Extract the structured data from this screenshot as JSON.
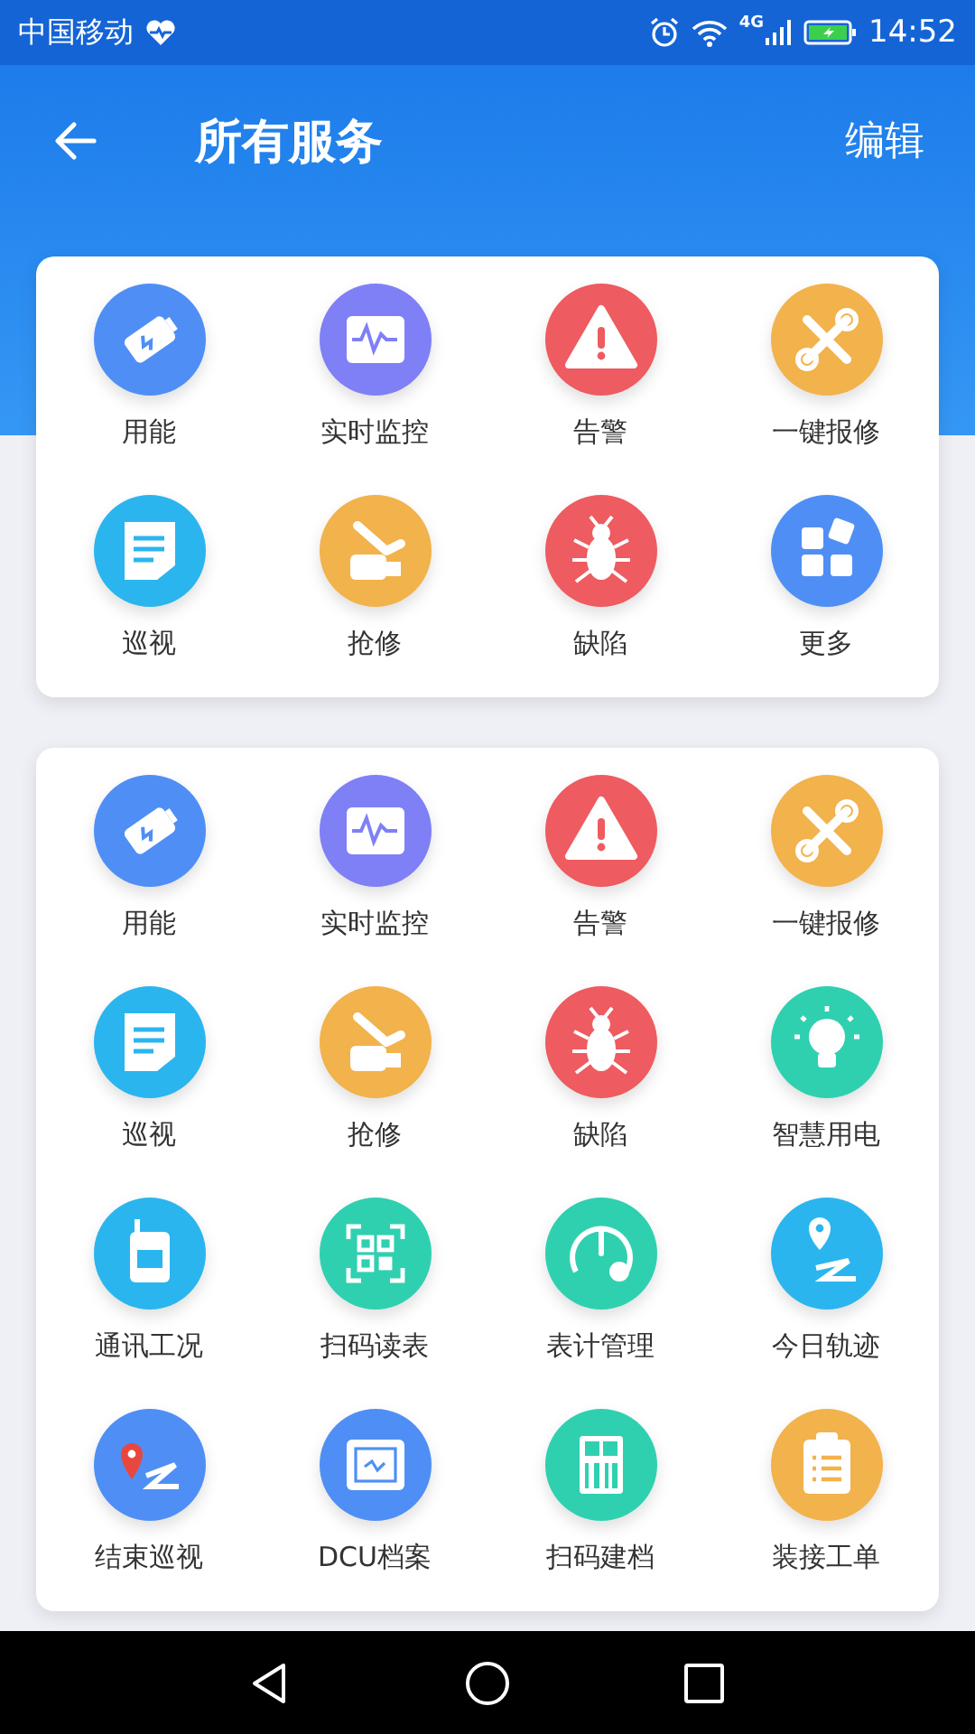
{
  "status_bar": {
    "carrier": "中国移动",
    "network": "4G",
    "time": "14:52"
  },
  "header": {
    "title": "所有服务",
    "action": "编辑"
  },
  "sections": [
    {
      "items": [
        {
          "label": "用能",
          "kind": "battery",
          "color": "#4f8ff5"
        },
        {
          "label": "实时监控",
          "kind": "monitor",
          "color": "#7f80f6"
        },
        {
          "label": "告警",
          "kind": "warning",
          "color": "#ee5b60"
        },
        {
          "label": "一键报修",
          "kind": "tools",
          "color": "#f2b24c"
        },
        {
          "label": "巡视",
          "kind": "document",
          "color": "#2bb5ee"
        },
        {
          "label": "抢修",
          "kind": "repair",
          "color": "#f2b24c"
        },
        {
          "label": "缺陷",
          "kind": "bug",
          "color": "#ee5b60"
        },
        {
          "label": "更多",
          "kind": "grid",
          "color": "#4f8ff5"
        }
      ]
    },
    {
      "items": [
        {
          "label": "用能",
          "kind": "battery",
          "color": "#4f8ff5"
        },
        {
          "label": "实时监控",
          "kind": "monitor",
          "color": "#7f80f6"
        },
        {
          "label": "告警",
          "kind": "warning",
          "color": "#ee5b60"
        },
        {
          "label": "一键报修",
          "kind": "tools",
          "color": "#f2b24c"
        },
        {
          "label": "巡视",
          "kind": "document",
          "color": "#2bb5ee"
        },
        {
          "label": "抢修",
          "kind": "repair",
          "color": "#f2b24c"
        },
        {
          "label": "缺陷",
          "kind": "bug",
          "color": "#ee5b60"
        },
        {
          "label": "智慧用电",
          "kind": "bulb",
          "color": "#2fd0b0"
        },
        {
          "label": "通讯工况",
          "kind": "terminal",
          "color": "#2bb5ee"
        },
        {
          "label": "扫码读表",
          "kind": "qrcode",
          "color": "#2fd0b0"
        },
        {
          "label": "表计管理",
          "kind": "gauge",
          "color": "#2fd0b0"
        },
        {
          "label": "今日轨迹",
          "kind": "route",
          "color": "#2bb5ee"
        },
        {
          "label": "结束巡视",
          "kind": "pinroute",
          "color": "#4f8ff5"
        },
        {
          "label": "DCU档案",
          "kind": "dcu",
          "color": "#4f8ff5"
        },
        {
          "label": "扫码建档",
          "kind": "barcode",
          "color": "#2fd0b0"
        },
        {
          "label": "装接工单",
          "kind": "clipboard",
          "color": "#f2b24c"
        }
      ]
    }
  ]
}
